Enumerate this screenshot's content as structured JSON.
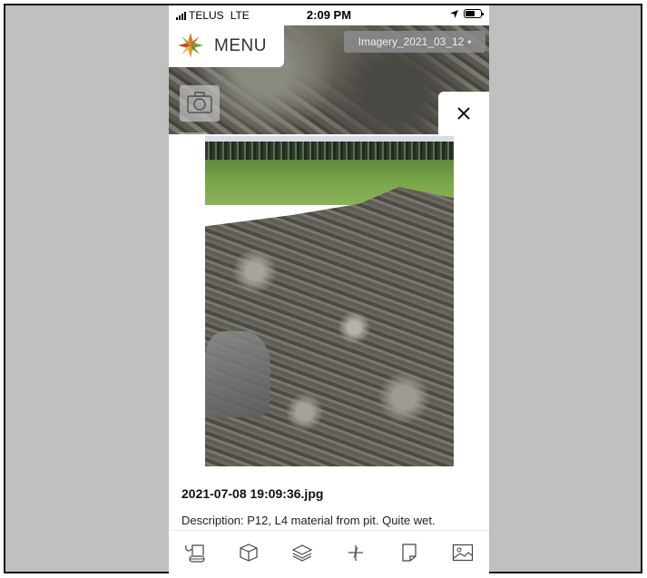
{
  "status_bar": {
    "carrier": "TELUS",
    "network": "LTE",
    "time": "2:09 PM"
  },
  "header": {
    "menu_label": "MENU",
    "imagery_select_value": "Imagery_2021_03_12"
  },
  "popup": {
    "filename": "2021-07-08 19:09:36.jpg",
    "description": "Description: P12, L4 material from pit. Quite wet."
  },
  "toolbar": {
    "items": [
      {
        "icon": "excavator-icon"
      },
      {
        "icon": "cube-icon"
      },
      {
        "icon": "layers-icon"
      },
      {
        "icon": "measure-icon"
      },
      {
        "icon": "note-icon"
      },
      {
        "icon": "image-icon"
      }
    ]
  },
  "colors": {
    "background": "#c0c0c0",
    "panel": "#ffffff",
    "icon": "#444444"
  }
}
